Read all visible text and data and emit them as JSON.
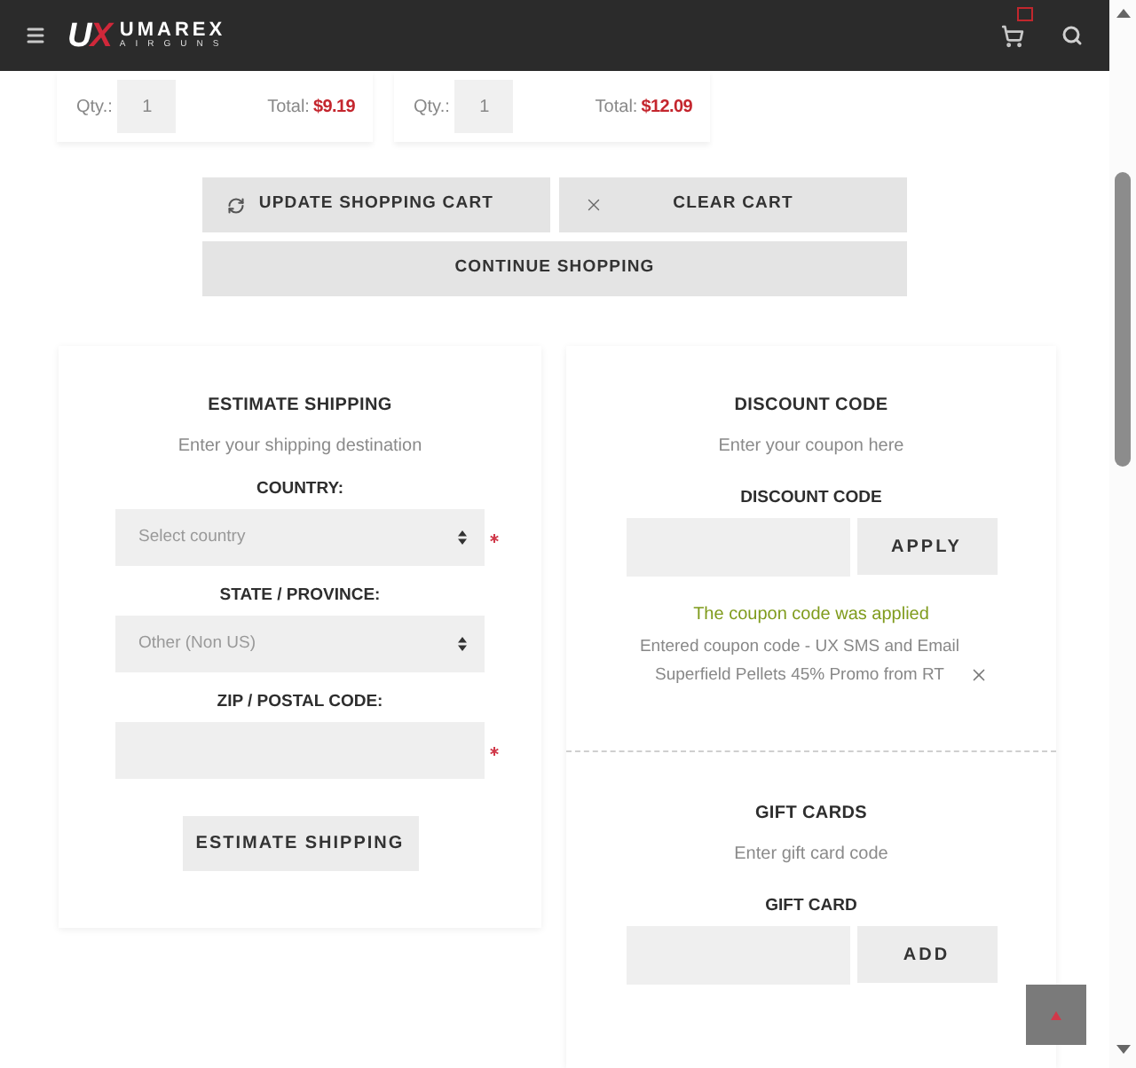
{
  "header": {
    "logo": {
      "mark": "UX",
      "name": "UMAREX",
      "tagline": "AIRGUNS"
    }
  },
  "cart_items": [
    {
      "qty_label": "Qty.:",
      "qty": "1",
      "total_label": "Total:",
      "total": "$9.19"
    },
    {
      "qty_label": "Qty.:",
      "qty": "1",
      "total_label": "Total:",
      "total": "$12.09"
    }
  ],
  "cart_actions": [
    {
      "kind": "update",
      "label": "UPDATE SHOPPING CART"
    },
    {
      "kind": "clear",
      "label": "CLEAR CART"
    },
    {
      "kind": "continue",
      "label": "CONTINUE SHOPPING"
    }
  ],
  "estimate_shipping": {
    "title": "ESTIMATE SHIPPING",
    "subtitle": "Enter your shipping destination",
    "fields": [
      {
        "kind": "select",
        "label": "COUNTRY:",
        "value": "Select country",
        "required": true
      },
      {
        "kind": "select",
        "label": "STATE / PROVINCE:",
        "value": "Other (Non US)",
        "required": false
      },
      {
        "kind": "text",
        "label": "ZIP / POSTAL CODE:",
        "required": true
      }
    ],
    "button": "ESTIMATE SHIPPING"
  },
  "discount": {
    "title": "DISCOUNT CODE",
    "subtitle": "Enter your coupon here",
    "label": "DISCOUNT CODE",
    "button": "APPLY",
    "message": "The coupon code was applied",
    "applied_coupon": "Entered coupon code - UX SMS and Email Superfield Pellets 45% Promo from RT"
  },
  "gift_cards": {
    "title": "GIFT CARDS",
    "subtitle": "Enter gift card code",
    "label": "GIFT CARD",
    "button": "ADD"
  }
}
